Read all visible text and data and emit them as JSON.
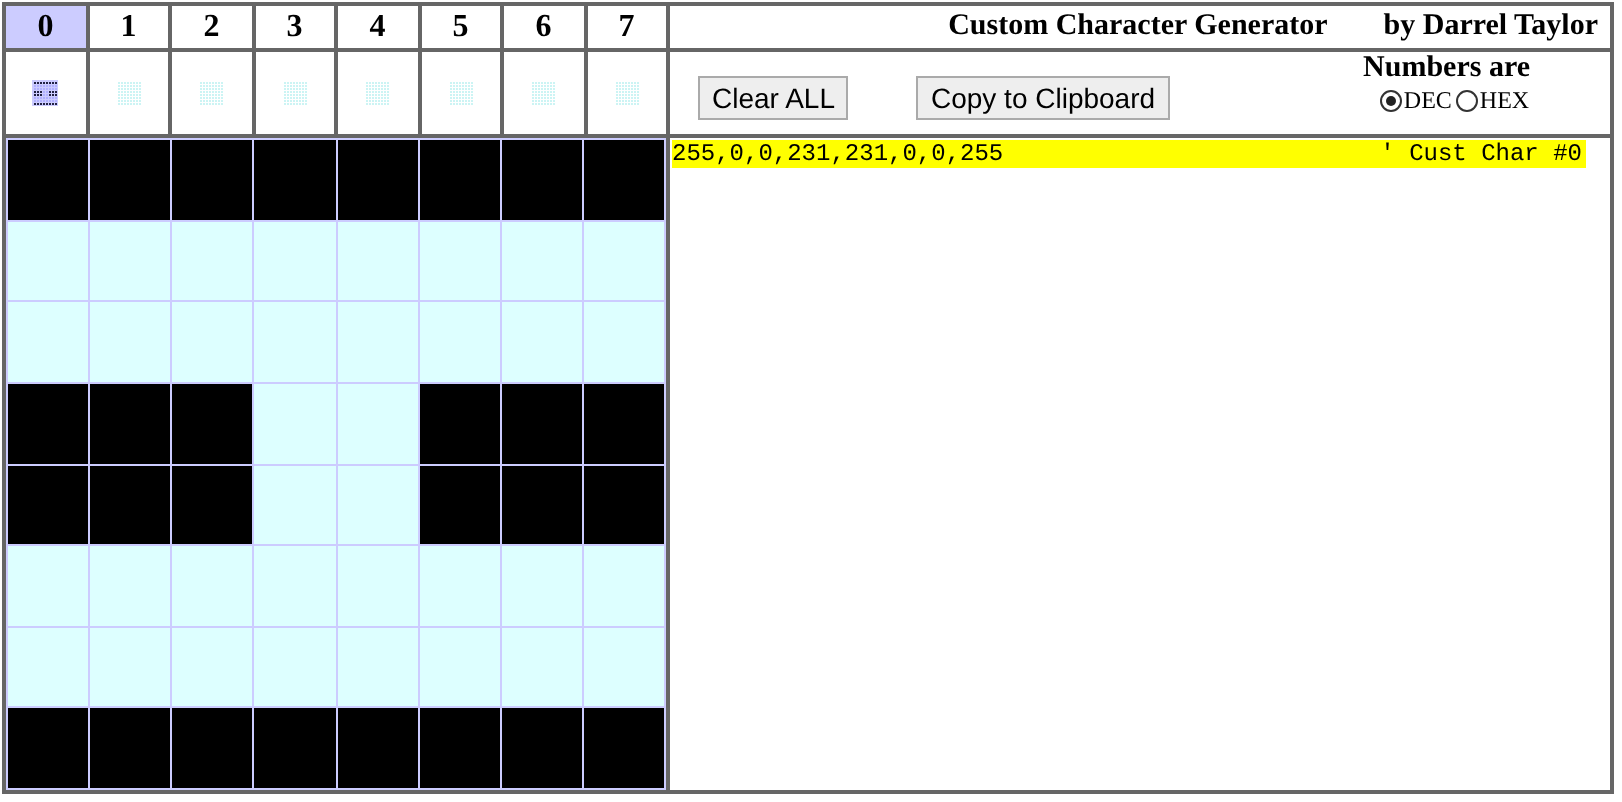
{
  "title": "Custom Character Generator",
  "author": "by Darrel Taylor",
  "characters": [
    {
      "label": "0",
      "selected": true
    },
    {
      "label": "1",
      "selected": false
    },
    {
      "label": "2",
      "selected": false
    },
    {
      "label": "3",
      "selected": false
    },
    {
      "label": "4",
      "selected": false
    },
    {
      "label": "5",
      "selected": false
    },
    {
      "label": "6",
      "selected": false
    },
    {
      "label": "7",
      "selected": false
    }
  ],
  "buttons": [
    "Clear ALL",
    "Copy to Clipboard"
  ],
  "format": {
    "label": "Numbers are",
    "options": [
      {
        "label": "DEC",
        "selected": true
      },
      {
        "label": "HEX",
        "selected": false
      }
    ]
  },
  "pixels": [
    [
      true,
      true,
      true,
      true,
      true,
      true,
      true,
      true
    ],
    [
      false,
      false,
      false,
      false,
      false,
      false,
      false,
      false
    ],
    [
      false,
      false,
      false,
      false,
      false,
      false,
      false,
      false
    ],
    [
      true,
      true,
      true,
      false,
      false,
      true,
      true,
      true
    ],
    [
      true,
      true,
      true,
      false,
      false,
      true,
      true,
      true
    ],
    [
      false,
      false,
      false,
      false,
      false,
      false,
      false,
      false
    ],
    [
      false,
      false,
      false,
      false,
      false,
      false,
      false,
      false
    ],
    [
      true,
      true,
      true,
      true,
      true,
      true,
      true,
      true
    ]
  ],
  "output": {
    "values": "255,0,0,231,231,0,0,255",
    "comment": "' Cust Char #0"
  }
}
